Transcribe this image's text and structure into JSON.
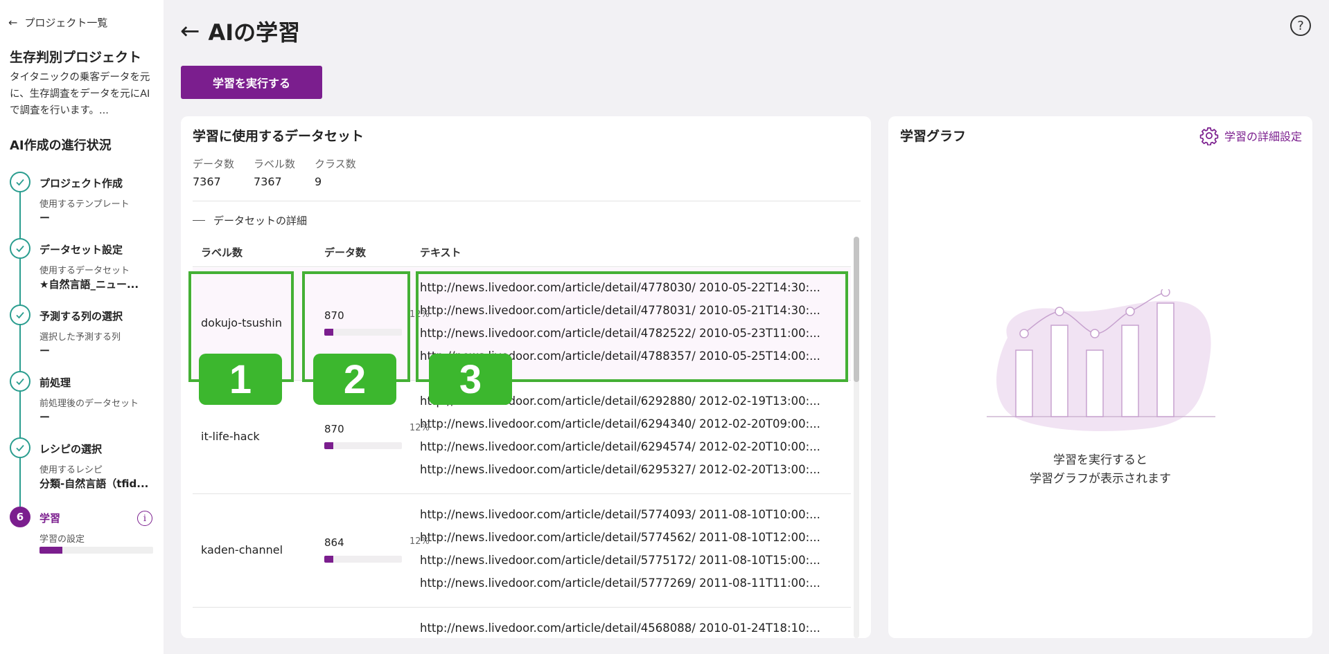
{
  "sidebar": {
    "back_label": "プロジェクト一覧",
    "project_name": "生存判別プロジェクト",
    "project_desc": "タイタニックの乗客データを元に、生存調査をデータを元にAIで調査を行います。...",
    "progress_title": "AI作成の進行状況",
    "steps": [
      {
        "title": "プロジェクト作成",
        "sub": "使用するテンプレート",
        "value": "ー"
      },
      {
        "title": "データセット設定",
        "sub": "使用するデータセット",
        "value": "★自然言語_ニュー..."
      },
      {
        "title": "予測する列の選択",
        "sub": "選択した予測する列",
        "value": "ー"
      },
      {
        "title": "前処理",
        "sub": "前処理後のデータセット",
        "value": "ー"
      },
      {
        "title": "レシピの選択",
        "sub": "使用するレシピ",
        "value": "分類-自然言語（tfid..."
      },
      {
        "number": "6",
        "title": "学習",
        "sub": "学習の設定",
        "progress": 0.2,
        "info": "i"
      }
    ]
  },
  "header": {
    "title": "AIの学習",
    "help": "?",
    "run_button": "学習を実行する"
  },
  "dataset": {
    "title": "学習に使用するデータセット",
    "stats": [
      {
        "label": "データ数",
        "value": "7367"
      },
      {
        "label": "ラベル数",
        "value": "7367"
      },
      {
        "label": "クラス数",
        "value": "9"
      }
    ],
    "details_label": "データセットの詳細",
    "columns": [
      "ラベル数",
      "データ数",
      "テキスト"
    ],
    "rows": [
      {
        "label": "dokujo-tsushin",
        "count": "870",
        "pct": "12%",
        "fraction": 0.12,
        "texts": [
          "http://news.livedoor.com/article/detail/4778030/ 2010-05-22T14:30:...",
          "http://news.livedoor.com/article/detail/4778031/ 2010-05-21T14:30:...",
          "http://news.livedoor.com/article/detail/4782522/ 2010-05-23T11:00:...",
          "http://news.livedoor.com/article/detail/4788357/ 2010-05-25T14:00:..."
        ]
      },
      {
        "label": "it-life-hack",
        "count": "870",
        "pct": "12%",
        "fraction": 0.12,
        "texts": [
          "http://news.livedoor.com/article/detail/6292880/ 2012-02-19T13:00:...",
          "http://news.livedoor.com/article/detail/6294340/ 2012-02-20T09:00:...",
          "http://news.livedoor.com/article/detail/6294574/ 2012-02-20T10:00:...",
          "http://news.livedoor.com/article/detail/6295327/ 2012-02-20T13:00:..."
        ]
      },
      {
        "label": "kaden-channel",
        "count": "864",
        "pct": "12%",
        "fraction": 0.12,
        "texts": [
          "http://news.livedoor.com/article/detail/5774093/ 2011-08-10T10:00:...",
          "http://news.livedoor.com/article/detail/5774562/ 2011-08-10T12:00:...",
          "http://news.livedoor.com/article/detail/5775172/ 2011-08-10T15:00:...",
          "http://news.livedoor.com/article/detail/5777269/ 2011-08-11T11:00:..."
        ]
      },
      {
        "label": "",
        "count": "",
        "pct": "",
        "fraction": 0,
        "texts": [
          "http://news.livedoor.com/article/detail/4568088/ 2010-01-24T18:10:..."
        ]
      }
    ]
  },
  "annotations": [
    "1",
    "2",
    "3"
  ],
  "graph": {
    "title": "学習グラフ",
    "settings_label": "学習の詳細設定",
    "message_line1": "学習を実行すると",
    "message_line2": "学習グラフが表示されます"
  },
  "colors": {
    "accent": "#7b1e8e",
    "step_done": "#2a9d8f",
    "annotation": "#3cb72e"
  },
  "icons": [
    "back-arrow-icon",
    "check-icon",
    "info-icon",
    "help-icon",
    "gear-icon"
  ]
}
